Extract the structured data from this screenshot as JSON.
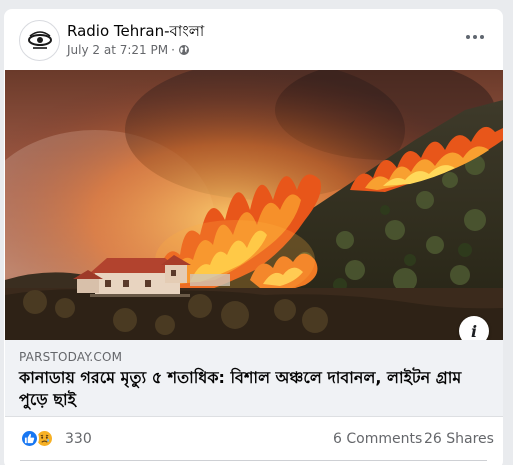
{
  "post": {
    "page_name": "Radio Tehran-বাংলা",
    "timestamp": "July 2 at 7:21 PM",
    "separator": "·",
    "privacy_icon": "globe-icon",
    "more_icon": "more-horizontal-icon"
  },
  "photo": {
    "description_icon": "info-icon",
    "info_label": "i"
  },
  "link": {
    "domain": "PARSTODAY.COM",
    "title": "কানাডায় গরমে মৃত্যু ৫ শতাধিক: বিশাল অঞ্চলে দাবানল, লাইটন গ্রাম পুড়ে ছাই"
  },
  "engagement": {
    "reactions": [
      "like-icon",
      "sad-icon"
    ],
    "reaction_count": "330",
    "comments": "6 Comments",
    "shares": "26 Shares"
  },
  "colors": {
    "facebook_blue": "#1877f2",
    "sad_yellow": "#f7b125",
    "secondary_text": "#65676b",
    "link_box_bg": "#f0f2f5"
  }
}
